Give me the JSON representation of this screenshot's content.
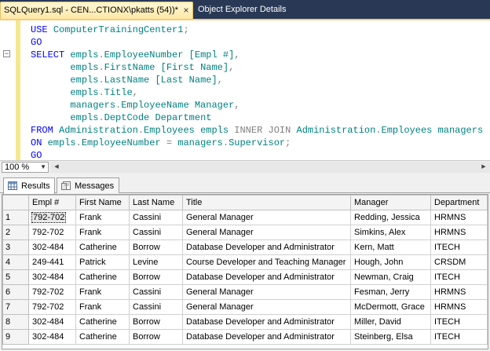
{
  "tabs": {
    "active_label": "SQLQuery1.sql - CEN...CTIONX\\pkatts (54))*",
    "close_glyph": "×",
    "inactive_label": "Object Explorer Details"
  },
  "editor": {
    "lines": [
      [
        {
          "c": "kw",
          "t": "USE "
        },
        {
          "c": "id",
          "t": "ComputerTrainingCenter1"
        },
        {
          "c": "pun",
          "t": ";"
        }
      ],
      [
        {
          "c": "kw",
          "t": "GO"
        }
      ],
      [
        {
          "c": "kw",
          "t": "SELECT "
        },
        {
          "c": "id",
          "t": "empls"
        },
        {
          "c": "pun",
          "t": "."
        },
        {
          "c": "id",
          "t": "EmployeeNumber "
        },
        {
          "c": "id",
          "t": "[Empl #]"
        },
        {
          "c": "pun",
          "t": ","
        }
      ],
      [
        {
          "c": "tx",
          "t": "       "
        },
        {
          "c": "id",
          "t": "empls"
        },
        {
          "c": "pun",
          "t": "."
        },
        {
          "c": "id",
          "t": "FirstName "
        },
        {
          "c": "id",
          "t": "[First Name]"
        },
        {
          "c": "pun",
          "t": ","
        }
      ],
      [
        {
          "c": "tx",
          "t": "       "
        },
        {
          "c": "id",
          "t": "empls"
        },
        {
          "c": "pun",
          "t": "."
        },
        {
          "c": "id",
          "t": "LastName "
        },
        {
          "c": "id",
          "t": "[Last Name]"
        },
        {
          "c": "pun",
          "t": ","
        }
      ],
      [
        {
          "c": "tx",
          "t": "       "
        },
        {
          "c": "id",
          "t": "empls"
        },
        {
          "c": "pun",
          "t": "."
        },
        {
          "c": "id",
          "t": "Title"
        },
        {
          "c": "pun",
          "t": ","
        }
      ],
      [
        {
          "c": "tx",
          "t": "       "
        },
        {
          "c": "id",
          "t": "managers"
        },
        {
          "c": "pun",
          "t": "."
        },
        {
          "c": "id",
          "t": "EmployeeName "
        },
        {
          "c": "id",
          "t": "Manager"
        },
        {
          "c": "pun",
          "t": ","
        }
      ],
      [
        {
          "c": "tx",
          "t": "       "
        },
        {
          "c": "id",
          "t": "empls"
        },
        {
          "c": "pun",
          "t": "."
        },
        {
          "c": "id",
          "t": "DeptCode "
        },
        {
          "c": "id",
          "t": "Department"
        }
      ],
      [
        {
          "c": "kw",
          "t": "FROM "
        },
        {
          "c": "id",
          "t": "Administration"
        },
        {
          "c": "pun",
          "t": "."
        },
        {
          "c": "id",
          "t": "Employees "
        },
        {
          "c": "id",
          "t": "empls "
        },
        {
          "c": "op",
          "t": "INNER JOIN "
        },
        {
          "c": "id",
          "t": "Administration"
        },
        {
          "c": "pun",
          "t": "."
        },
        {
          "c": "id",
          "t": "Employees "
        },
        {
          "c": "id",
          "t": "managers"
        }
      ],
      [
        {
          "c": "kw",
          "t": "ON "
        },
        {
          "c": "id",
          "t": "empls"
        },
        {
          "c": "pun",
          "t": "."
        },
        {
          "c": "id",
          "t": "EmployeeNumber "
        },
        {
          "c": "pun",
          "t": "= "
        },
        {
          "c": "id",
          "t": "managers"
        },
        {
          "c": "pun",
          "t": "."
        },
        {
          "c": "id",
          "t": "Supervisor"
        },
        {
          "c": "pun",
          "t": ";"
        }
      ],
      [
        {
          "c": "kw",
          "t": "GO"
        }
      ]
    ]
  },
  "zoom": {
    "value": "100 %"
  },
  "result_tabs": {
    "results_label": "Results",
    "messages_label": "Messages"
  },
  "grid": {
    "columns": [
      "Empl #",
      "First Name",
      "Last Name",
      "Title",
      "Manager",
      "Department"
    ],
    "rows": [
      [
        "1",
        "792-702",
        "Frank",
        "Cassini",
        "General Manager",
        "Redding, Jessica",
        "HRMNS"
      ],
      [
        "2",
        "792-702",
        "Frank",
        "Cassini",
        "General Manager",
        "Simkins, Alex",
        "HRMNS"
      ],
      [
        "3",
        "302-484",
        "Catherine",
        "Borrow",
        "Database Developer and Administrator",
        "Kern, Matt",
        "ITECH"
      ],
      [
        "4",
        "249-441",
        "Patrick",
        "Levine",
        "Course Developer and Teaching Manager",
        "Hough, John",
        "CRSDM"
      ],
      [
        "5",
        "302-484",
        "Catherine",
        "Borrow",
        "Database Developer and Administrator",
        "Newman, Craig",
        "ITECH"
      ],
      [
        "6",
        "792-702",
        "Frank",
        "Cassini",
        "General Manager",
        "Fesman, Jerry",
        "HRMNS"
      ],
      [
        "7",
        "792-702",
        "Frank",
        "Cassini",
        "General Manager",
        "McDermott, Grace",
        "HRMNS"
      ],
      [
        "8",
        "302-484",
        "Catherine",
        "Borrow",
        "Database Developer and Administrator",
        "Miller, David",
        "ITECH"
      ],
      [
        "9",
        "302-484",
        "Catherine",
        "Borrow",
        "Database Developer and Administrator",
        "Steinberg, Elsa",
        "ITECH"
      ]
    ]
  }
}
